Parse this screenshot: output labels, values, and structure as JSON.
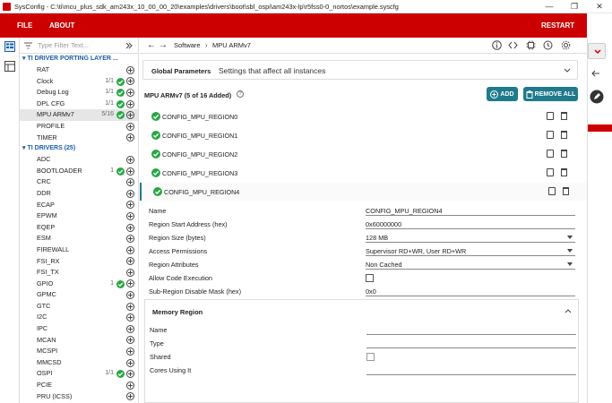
{
  "titlebar": {
    "title": "SysConfig - C:\\ti\\mcu_plus_sdk_am243x_10_00_00_20\\examples\\drivers\\boot\\sbl_ospi\\am243x-lp\\r5fss0-0_nortos\\example.syscfg",
    "minimize": "—",
    "maximize": "❐",
    "close": "✕"
  },
  "menu": {
    "file": "FILE",
    "about": "ABOUT",
    "restart": "RESTART"
  },
  "filter": {
    "placeholder": "Type Filter Text..."
  },
  "sidebar": {
    "porting_title": "TI DRIVER PORTING LAYER ...",
    "porting_items": [
      {
        "label": "RAT",
        "count": "",
        "ok": false
      },
      {
        "label": "Clock",
        "count": "1/1",
        "ok": true
      },
      {
        "label": "Debug Log",
        "count": "1/1",
        "ok": true
      },
      {
        "label": "DPL CFG",
        "count": "1/1",
        "ok": true
      },
      {
        "label": "MPU ARMv7",
        "count": "5/16",
        "ok": true,
        "selected": true
      },
      {
        "label": "PROFILE",
        "count": "",
        "ok": false
      },
      {
        "label": "TIMER",
        "count": "",
        "ok": false
      }
    ],
    "drivers_title": "TI DRIVERS (25)",
    "driver_items": [
      {
        "label": "ADC",
        "count": "",
        "ok": false
      },
      {
        "label": "BOOTLOADER",
        "count": "1",
        "ok": true
      },
      {
        "label": "CRC",
        "count": "",
        "ok": false
      },
      {
        "label": "DDR",
        "count": "",
        "ok": false
      },
      {
        "label": "ECAP",
        "count": "",
        "ok": false
      },
      {
        "label": "EPWM",
        "count": "",
        "ok": false
      },
      {
        "label": "EQEP",
        "count": "",
        "ok": false
      },
      {
        "label": "ESM",
        "count": "",
        "ok": false
      },
      {
        "label": "FIREWALL",
        "count": "",
        "ok": false
      },
      {
        "label": "FSI_RX",
        "count": "",
        "ok": false
      },
      {
        "label": "FSI_TX",
        "count": "",
        "ok": false
      },
      {
        "label": "GPIO",
        "count": "1",
        "ok": true
      },
      {
        "label": "GPMC",
        "count": "",
        "ok": false
      },
      {
        "label": "GTC",
        "count": "",
        "ok": false
      },
      {
        "label": "I2C",
        "count": "",
        "ok": false
      },
      {
        "label": "IPC",
        "count": "",
        "ok": false
      },
      {
        "label": "MCAN",
        "count": "",
        "ok": false
      },
      {
        "label": "MCSPI",
        "count": "",
        "ok": false
      },
      {
        "label": "MMCSD",
        "count": "",
        "ok": false
      },
      {
        "label": "OSPI",
        "count": "1/1",
        "ok": true
      },
      {
        "label": "PCIE",
        "count": "",
        "ok": false
      },
      {
        "label": "PRU (ICSS)",
        "count": "",
        "ok": false
      }
    ]
  },
  "breadcrumb": {
    "back": "←",
    "forward": "→",
    "software": "Software",
    "sep": "›",
    "current": "MPU ARMv7"
  },
  "global": {
    "title": "Global Parameters",
    "subtitle": "Settings that affect all instances"
  },
  "module": {
    "title": "MPU ARMv7 (5 of 16 Added)",
    "info": "?",
    "add": "ADD",
    "remove_all": "REMOVE ALL"
  },
  "regions": [
    "CONFIG_MPU_REGION0",
    "CONFIG_MPU_REGION1",
    "CONFIG_MPU_REGION2",
    "CONFIG_MPU_REGION3",
    "CONFIG_MPU_REGION4"
  ],
  "form": {
    "name_label": "Name",
    "name_value": "CONFIG_MPU_REGION4",
    "start_label": "Region Start Address (hex)",
    "start_value": "0x60000000",
    "size_label": "Region Size (bytes)",
    "size_value": "128 MB",
    "access_label": "Access Permissions",
    "access_value": "Supervisor RD+WR, User RD+WR",
    "attr_label": "Region Attributes",
    "attr_value": "Non Cached",
    "exec_label": "Allow Code Execution",
    "subregion_label": "Sub-Region Disable Mask (hex)",
    "subregion_value": "0x0"
  },
  "memory_region": {
    "title": "Memory Region",
    "name_label": "Name",
    "type_label": "Type",
    "shared_label": "Shared",
    "cores_label": "Cores Using It"
  },
  "colors": {
    "accent_red": "#cc0000",
    "teal": "#1f7a8c",
    "ok_green": "#28a745",
    "section_blue": "#1a5fa8"
  }
}
